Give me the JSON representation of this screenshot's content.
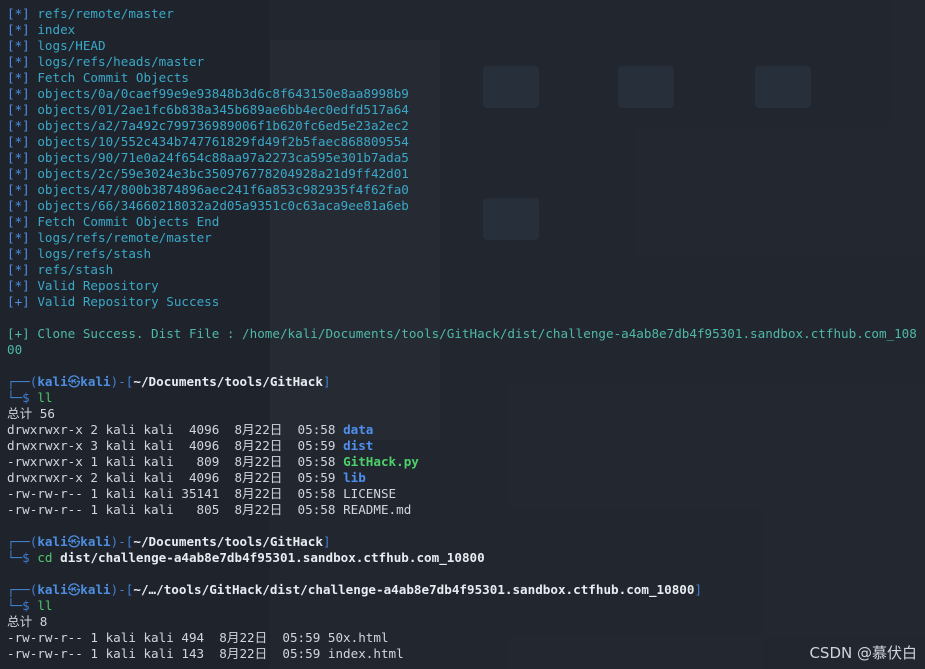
{
  "log_lines": [
    {
      "tag": "[*]",
      "msg": "refs/remote/master"
    },
    {
      "tag": "[*]",
      "msg": "index"
    },
    {
      "tag": "[*]",
      "msg": "logs/HEAD"
    },
    {
      "tag": "[*]",
      "msg": "logs/refs/heads/master"
    },
    {
      "tag": "[*]",
      "msg": "Fetch Commit Objects"
    },
    {
      "tag": "[*]",
      "msg": "objects/0a/0caef99e9e93848b3d6c8f643150e8aa8998b9"
    },
    {
      "tag": "[*]",
      "msg": "objects/01/2ae1fc6b838a345b689ae6bb4ec0edfd517a64"
    },
    {
      "tag": "[*]",
      "msg": "objects/a2/7a492c799736989006f1b620fc6ed5e23a2ec2"
    },
    {
      "tag": "[*]",
      "msg": "objects/10/552c434b747761829fd49f2b5faec868809554"
    },
    {
      "tag": "[*]",
      "msg": "objects/90/71e0a24f654c88aa97a2273ca595e301b7ada5"
    },
    {
      "tag": "[*]",
      "msg": "objects/2c/59e3024e3bc350976778204928a21d9ff42d01"
    },
    {
      "tag": "[*]",
      "msg": "objects/47/800b3874896aec241f6a853c982935f4f62fa0"
    },
    {
      "tag": "[*]",
      "msg": "objects/66/34660218032a2d05a9351c0c63aca9ee81a6eb"
    },
    {
      "tag": "[*]",
      "msg": "Fetch Commit Objects End"
    },
    {
      "tag": "[*]",
      "msg": "logs/refs/remote/master"
    },
    {
      "tag": "[*]",
      "msg": "logs/refs/stash"
    },
    {
      "tag": "[*]",
      "msg": "refs/stash"
    },
    {
      "tag": "[*]",
      "msg": "Valid Repository"
    },
    {
      "tag": "[+]",
      "msg": "Valid Repository Success"
    }
  ],
  "clone_line": "[+] Clone Success. Dist File : /home/kali/Documents/tools/GitHack/dist/challenge-a4ab8e7db4f95301.sandbox.ctfhub.com_10800",
  "prompt": {
    "user": "kali",
    "at": "㉿",
    "host": "kali",
    "corner_top": "┌──(",
    "corner_bottom": "└─$ ",
    "open_dir": ")-[",
    "close_dir": "]"
  },
  "blocks": [
    {
      "dir": "~/Documents/tools/GitHack",
      "cmd": "ll",
      "total": "总计 56",
      "rows": [
        {
          "perm": "drwxrwxr-x 2 kali kali  4096  8月22日  05:58 ",
          "name": "data",
          "kind": "dir"
        },
        {
          "perm": "drwxrwxr-x 3 kali kali  4096  8月22日  05:59 ",
          "name": "dist",
          "kind": "dir"
        },
        {
          "perm": "-rwxrwxr-x 1 kali kali   809  8月22日  05:58 ",
          "name": "GitHack.py",
          "kind": "exe"
        },
        {
          "perm": "drwxrwxr-x 2 kali kali  4096  8月22日  05:59 ",
          "name": "lib",
          "kind": "dir"
        },
        {
          "perm": "-rw-rw-r-- 1 kali kali 35141  8月22日  05:58 ",
          "name": "LICENSE",
          "kind": "file"
        },
        {
          "perm": "-rw-rw-r-- 1 kali kali   805  8月22日  05:58 ",
          "name": "README.md",
          "kind": "file"
        }
      ]
    },
    {
      "dir": "~/Documents/tools/GitHack",
      "cmd": "cd",
      "cmd_arg": "dist/challenge-a4ab8e7db4f95301.sandbox.ctfhub.com_10800"
    },
    {
      "dir": "~/…/tools/GitHack/dist/challenge-a4ab8e7db4f95301.sandbox.ctfhub.com_10800",
      "cmd": "ll",
      "total": "总计 8",
      "rows": [
        {
          "perm": "-rw-rw-r-- 1 kali kali 494  8月22日  05:59 ",
          "name": "50x.html",
          "kind": "file"
        },
        {
          "perm": "-rw-rw-r-- 1 kali kali 143  8月22日  05:59 ",
          "name": "index.html",
          "kind": "file"
        }
      ]
    }
  ],
  "watermark": "CSDN @慕伏白",
  "colors": {
    "background": "#1f242c",
    "log_text": "#3aa8c8",
    "prompt_user": "#4d8fe3",
    "dir_name": "#4f8ff0",
    "exe_name": "#4cd06a"
  }
}
